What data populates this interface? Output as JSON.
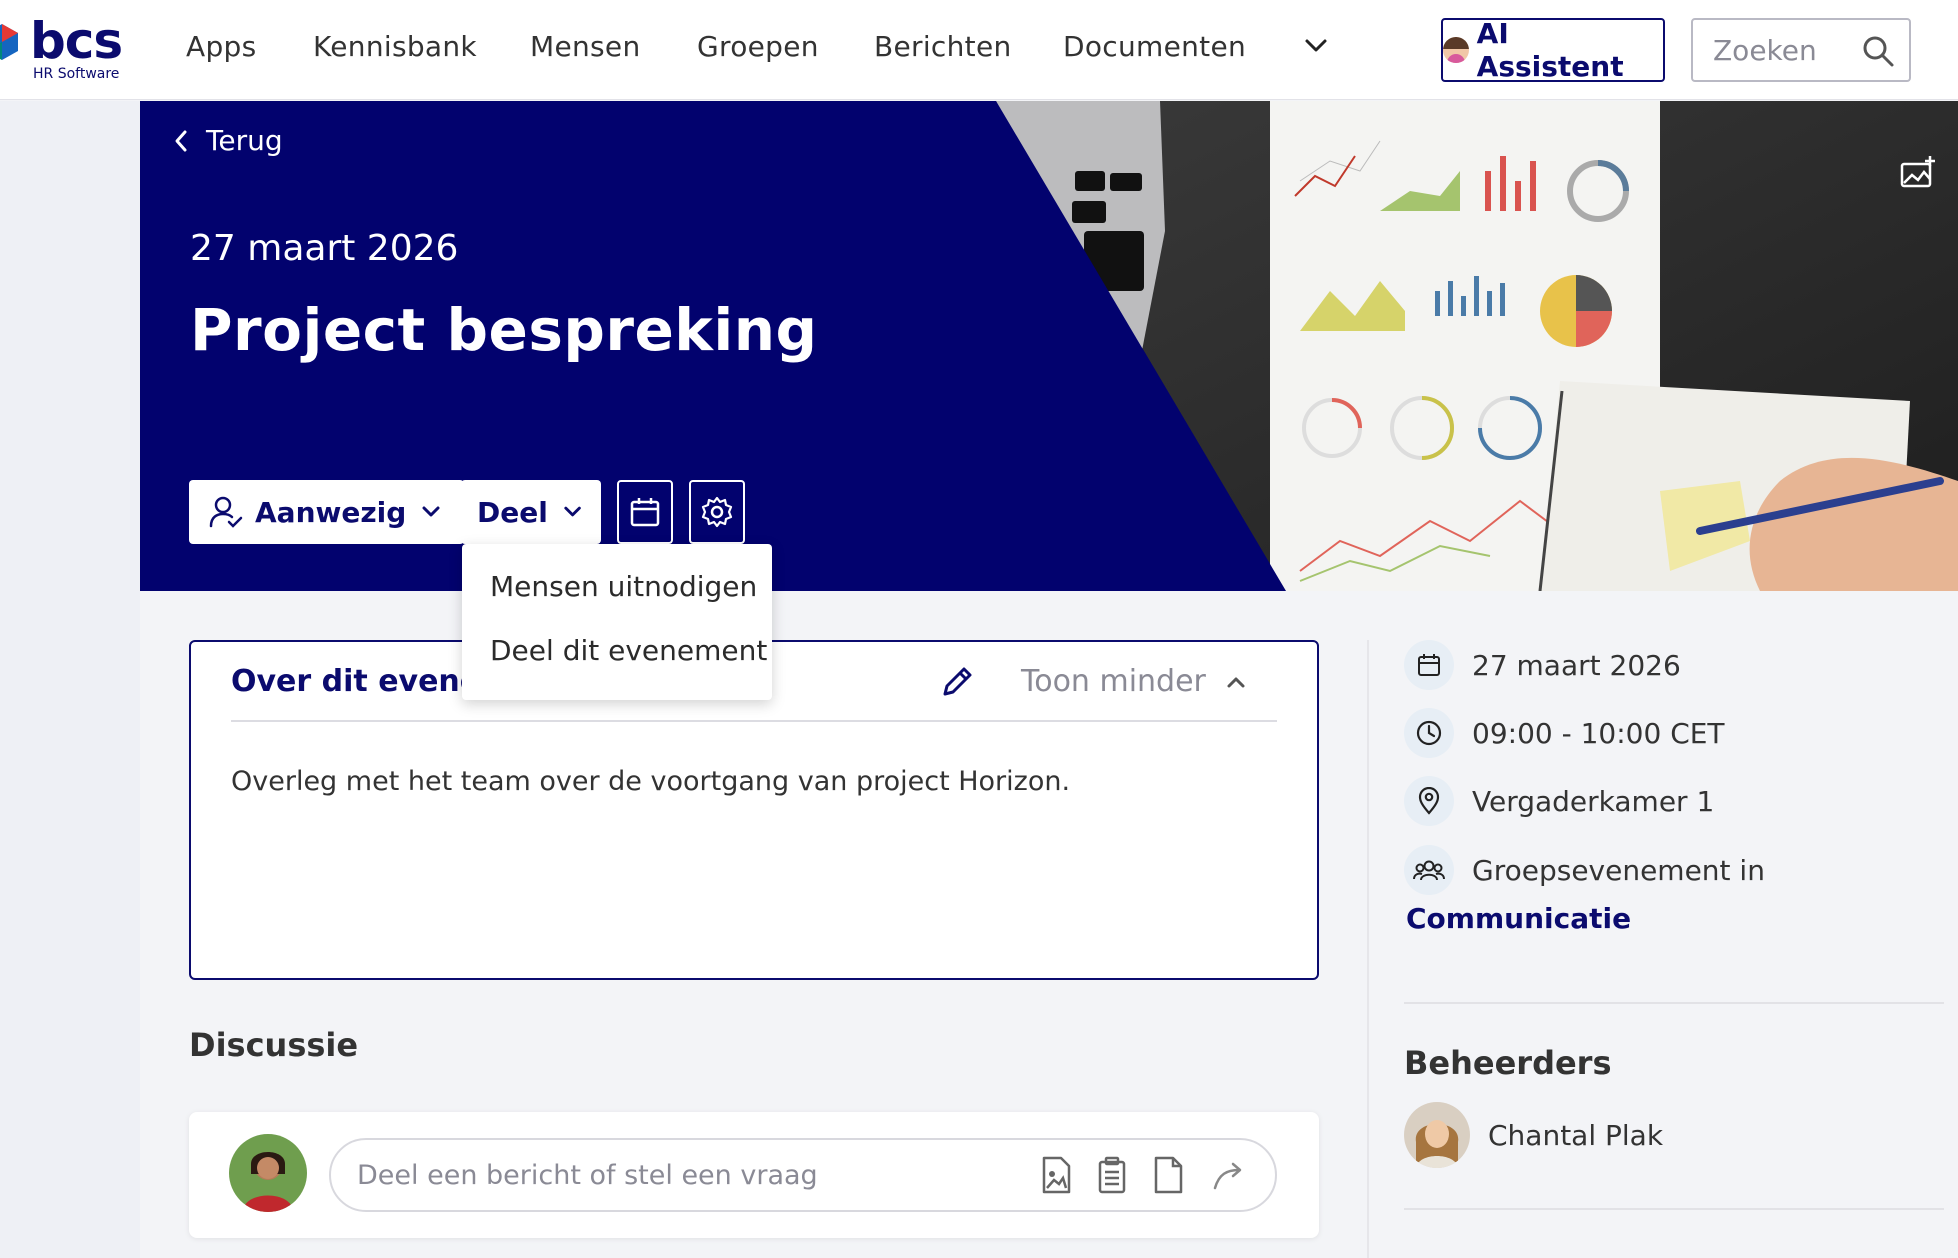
{
  "brand": {
    "name": "bcs",
    "subtitle": "HR Software"
  },
  "nav": {
    "items": [
      "Apps",
      "Kennisbank",
      "Mensen",
      "Groepen",
      "Berichten",
      "Documenten"
    ],
    "ai_label": "AI Assistent",
    "search_placeholder": "Zoeken"
  },
  "hero": {
    "back_label": "Terug",
    "date": "27 maart 2026",
    "title": "Project bespreking",
    "attend_label": "Aanwezig",
    "share_label": "Deel"
  },
  "share_menu": {
    "items": [
      "Mensen uitnodigen",
      "Deel dit evenement"
    ]
  },
  "about": {
    "title": "Over dit evenement",
    "toggle_label": "Toon minder",
    "description": "Overleg met het team over de voortgang van project Horizon."
  },
  "discussion": {
    "title": "Discussie",
    "placeholder": "Deel een bericht of stel een vraag"
  },
  "details": {
    "date": "27 maart 2026",
    "time": "09:00 - 10:00 CET",
    "location": "Vergaderkamer 1",
    "group_prefix": "Groepsevenement in",
    "group_name": "Communicatie"
  },
  "admins": {
    "title": "Beheerders",
    "people": [
      {
        "name": "Chantal Plak"
      }
    ]
  },
  "colors": {
    "brand_navy": "#02026e",
    "accent_text": "#0b0b6e"
  }
}
